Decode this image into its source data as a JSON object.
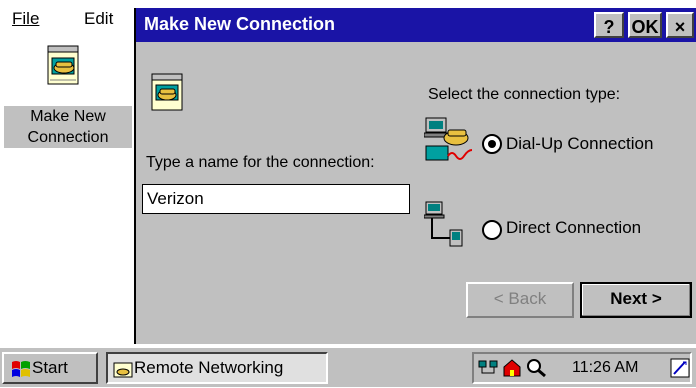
{
  "menubar": {
    "file": "File",
    "edit": "Edit"
  },
  "desktop_item": {
    "label_line1": "Make New",
    "label_line2": "Connection"
  },
  "dialog": {
    "title": "Make New Connection",
    "help_button": "?",
    "ok_button": "OK",
    "close_button": "×",
    "name_label": "Type a name for the connection:",
    "name_value": "Verizon",
    "type_label": "Select the connection type:",
    "options": [
      {
        "label": "Dial-Up Connection",
        "selected": true
      },
      {
        "label": "Direct Connection",
        "selected": false
      }
    ],
    "back_button": "< Back",
    "next_button": "Next >"
  },
  "taskbar": {
    "start_label": "Start",
    "task_label": "Remote Networking",
    "clock": "11:26 AM"
  },
  "colors": {
    "title_bar": "#1a14a6",
    "dialog_face": "#c0c0c0"
  }
}
